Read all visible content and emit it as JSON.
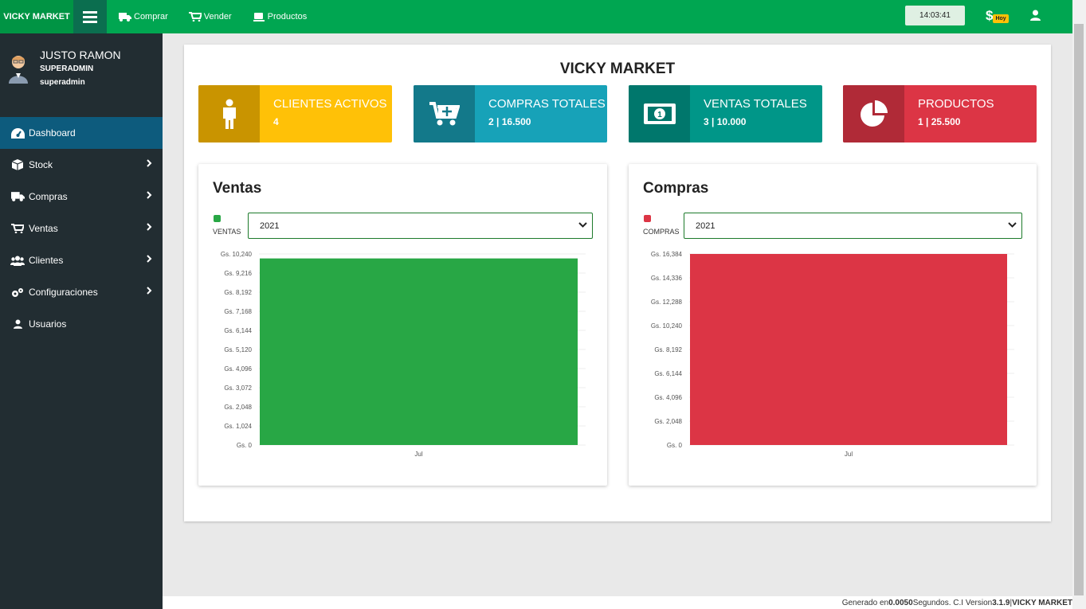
{
  "topbar": {
    "brand": "VICKY MARKET",
    "links": [
      {
        "label": "Comprar",
        "icon": "truck-icon"
      },
      {
        "label": "Vender",
        "icon": "cart-icon"
      },
      {
        "label": "Productos",
        "icon": "product-icon"
      }
    ],
    "clock": "14:03:41",
    "cash_symbol": "$",
    "cash_badge": "Hoy"
  },
  "sidebar": {
    "user_name": "JUSTO RAMON",
    "user_role": "SUPERADMIN",
    "user_login": "superadmin",
    "items": [
      {
        "label": "Dashboard",
        "icon": "dashboard-icon",
        "active": true
      },
      {
        "label": "Stock",
        "icon": "box-icon"
      },
      {
        "label": "Compras",
        "icon": "truck-icon"
      },
      {
        "label": "Ventas",
        "icon": "cart-icon"
      },
      {
        "label": "Clientes",
        "icon": "users-icon"
      },
      {
        "label": "Configuraciones",
        "icon": "gears-icon"
      },
      {
        "label": "Usuarios",
        "icon": "user-icon"
      }
    ]
  },
  "main": {
    "title": "VICKY MARKET",
    "boxes": [
      {
        "label": "CLIENTES ACTIVOS",
        "value": "4",
        "icon": "person-icon",
        "color": "#ffc107",
        "dark": "#c99400"
      },
      {
        "label": "COMPRAS TOTALES",
        "value_count": "2",
        "value_amount": "16.500",
        "icon": "cart-plus-icon",
        "color": "#17a2b8",
        "dark": "#13798a"
      },
      {
        "label": "VENTAS TOTALES",
        "value_count": "3",
        "value_amount": "10.000",
        "icon": "money-icon",
        "color": "#009688",
        "dark": "#00776c"
      },
      {
        "label": "PRODUCTOS",
        "value_count": "1",
        "value_amount": "25.500",
        "icon": "pie-icon",
        "color": "#dc3545",
        "dark": "#b02a37"
      }
    ],
    "ventas": {
      "title": "Ventas",
      "legend": "VENTAS",
      "year": "2021"
    },
    "compras": {
      "title": "Compras",
      "legend": "COMPRAS",
      "year": "2021"
    }
  },
  "footer": {
    "prefix": "Generado en ",
    "time": "0.0050",
    "mid": " Segundos. C.I Version ",
    "version": "3.1.9",
    "sep": " | ",
    "brand": "VICKY MARKET"
  },
  "chart_data": [
    {
      "type": "bar",
      "categories": [
        "Jul"
      ],
      "series": [
        {
          "name": "VENTAS",
          "values": [
            10000
          ]
        }
      ],
      "color": "#28a745",
      "ylim": [
        0,
        10240
      ],
      "yticks": [
        "Gs. 0",
        "Gs. 1,024",
        "Gs. 2,048",
        "Gs. 3,072",
        "Gs. 4,096",
        "Gs. 5,120",
        "Gs. 6,144",
        "Gs. 7,168",
        "Gs. 8,192",
        "Gs. 9,216",
        "Gs. 10,240"
      ]
    },
    {
      "type": "bar",
      "categories": [
        "Jul"
      ],
      "series": [
        {
          "name": "COMPRAS",
          "values": [
            16384
          ]
        }
      ],
      "color": "#dc3545",
      "ylim": [
        0,
        16384
      ],
      "yticks": [
        "Gs. 0",
        "Gs. 2,048",
        "Gs. 4,096",
        "Gs. 6,144",
        "Gs. 8,192",
        "Gs. 10,240",
        "Gs. 12,288",
        "Gs. 14,336",
        "Gs. 16,384"
      ]
    }
  ]
}
